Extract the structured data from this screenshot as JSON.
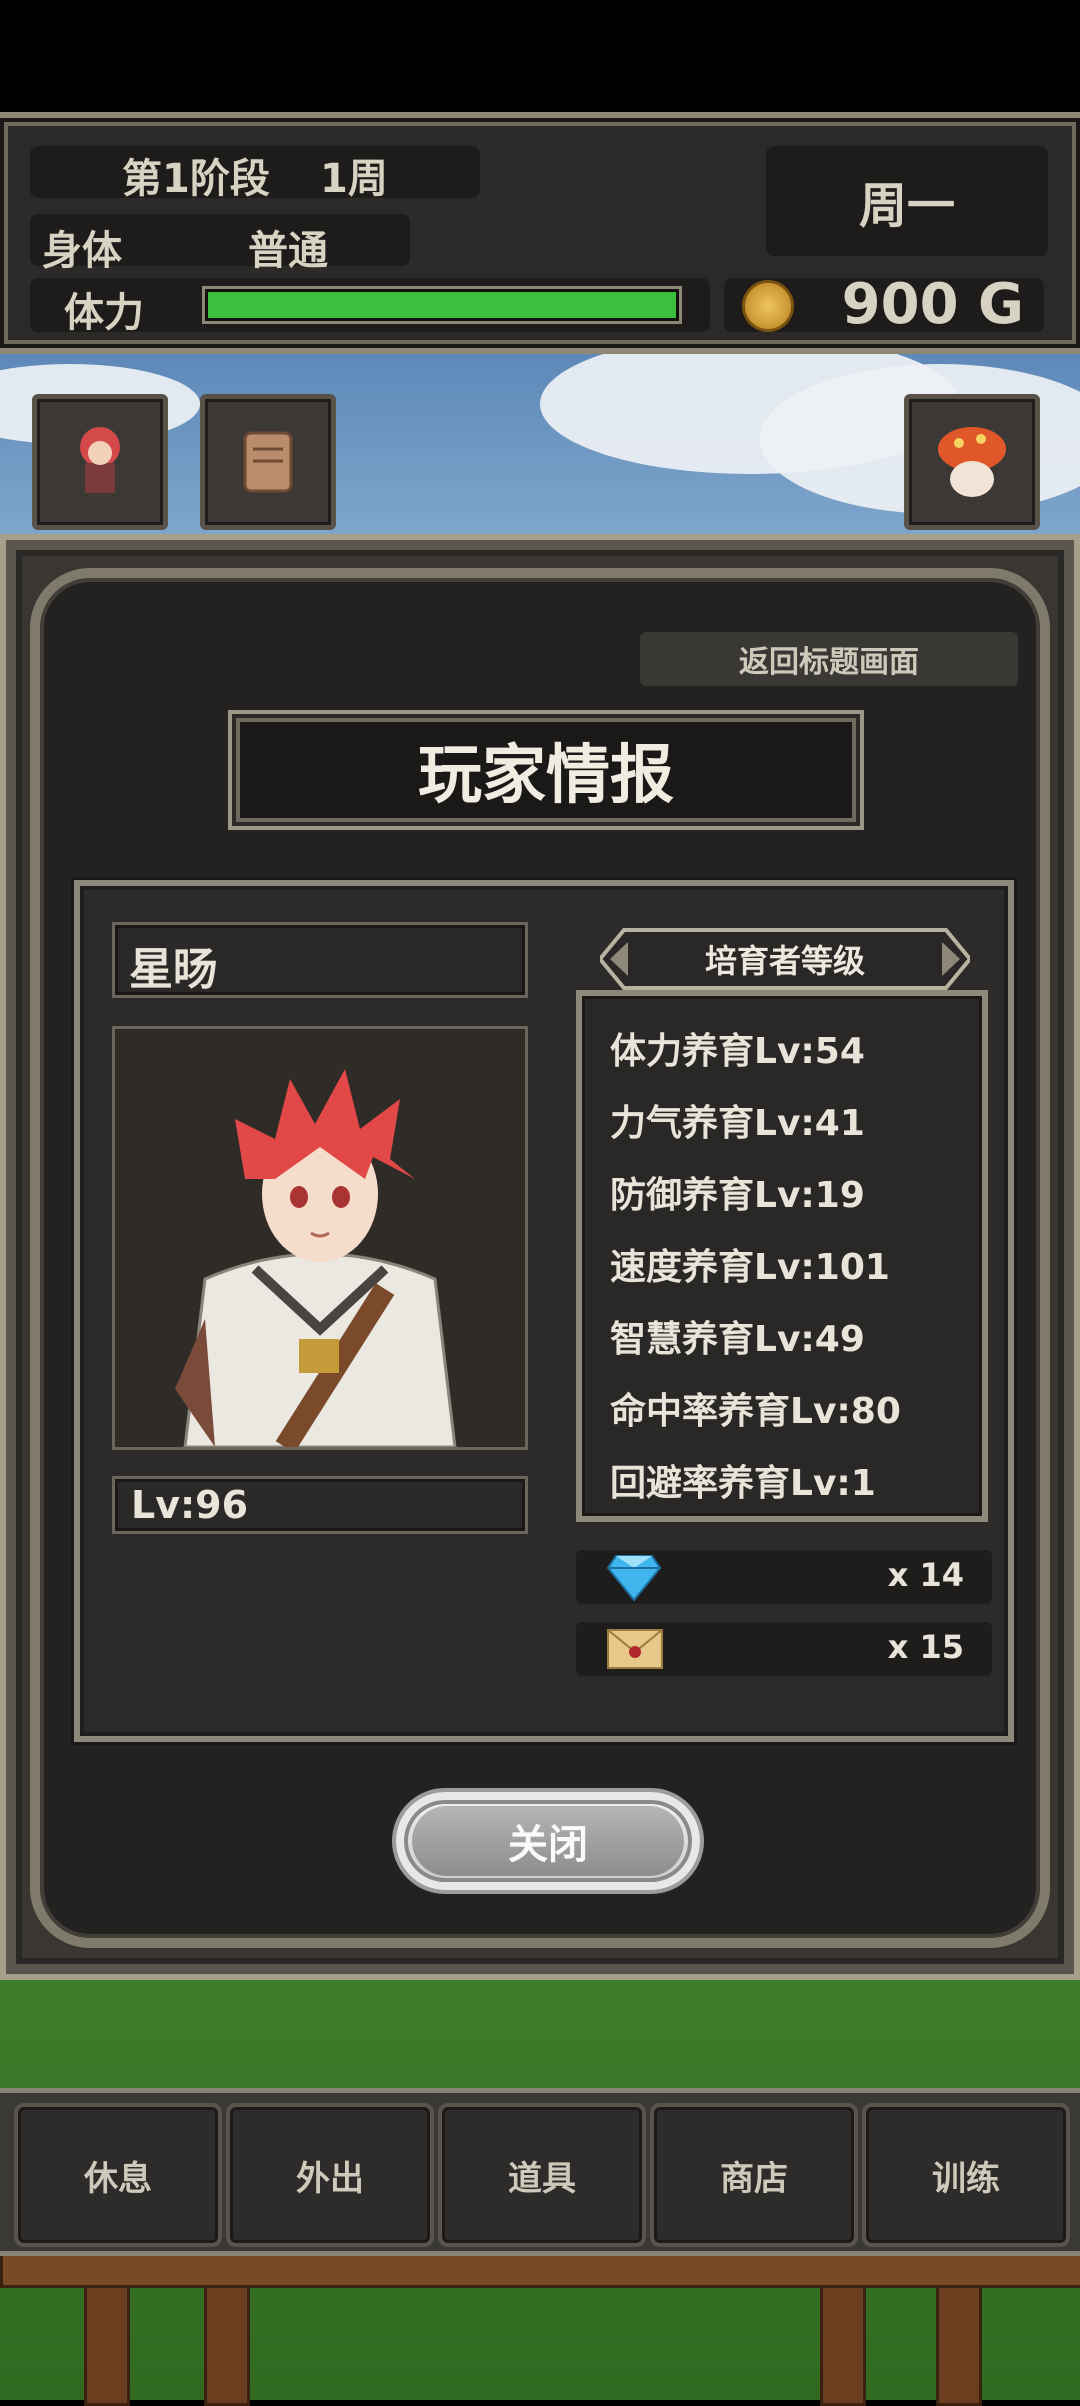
{
  "status": {
    "stage": "第1阶段",
    "week": "1周",
    "body_label": "身体",
    "body_value": "普通",
    "stamina_label": "体力",
    "stamina_fraction": 1.0,
    "weekday": "周一",
    "gold": "900 G"
  },
  "modal": {
    "back_to_title": "返回标题画面",
    "title": "玩家情报",
    "player_name": "星旸",
    "player_level": "Lv:96",
    "trainer_header": "培育者等级",
    "trainer_levels": [
      "体力养育Lv:54",
      "力气养育Lv:41",
      "防御养育Lv:19",
      "速度养育Lv:101",
      "智慧养育Lv:49",
      "命中率养育Lv:80",
      "回避率养育Lv:1"
    ],
    "diamond_count": "x 14",
    "letter_count": "x 15",
    "close_label": "关闭"
  },
  "nav": [
    "休息",
    "外出",
    "道具",
    "商店",
    "训练"
  ],
  "colors": {
    "stamina_bar": "#3cbf3c",
    "diamond": "#3fb6ee",
    "gold_coin": "#d9a43a"
  }
}
